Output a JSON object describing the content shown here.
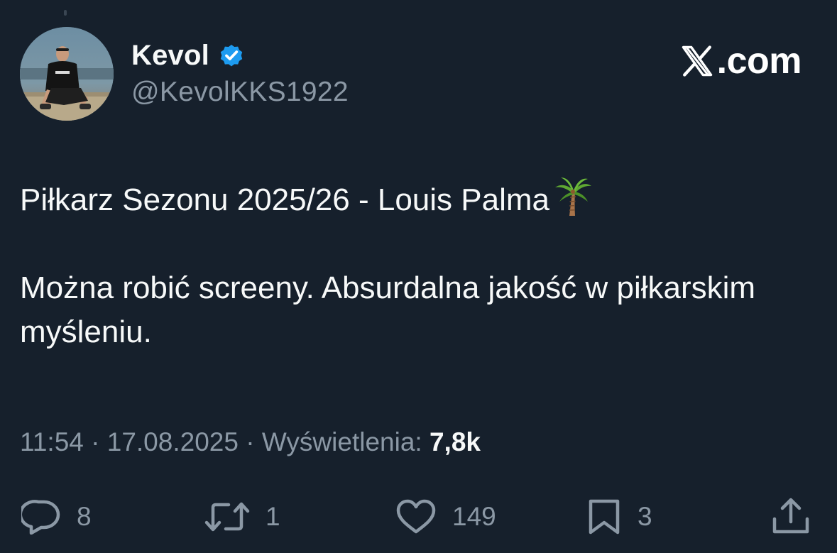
{
  "author": {
    "display_name": "Kevol",
    "handle": "@KevolKKS1922",
    "verified": true,
    "verified_icon": "verified-badge-icon",
    "badge_color": "#1d9bf0"
  },
  "brand": {
    "suffix": ".com",
    "icon": "x-logo-icon"
  },
  "tweet": {
    "line1": "Piłkarz Sezonu 2025/26 - Louis Palma",
    "line1_emoji_icon": "palm-tree-icon",
    "line2": "Można robić screeny. Absurdalna jakość w piłkarskim myśleniu."
  },
  "meta": {
    "time": "11:54",
    "separator": " · ",
    "date": "17.08.2025",
    "views_label": "Wyświetlenia:",
    "views_count": "7,8k"
  },
  "actions": {
    "reply_count": "8",
    "retweet_count": "1",
    "like_count": "149",
    "bookmark_count": "3"
  },
  "colors": {
    "background": "#16202c",
    "text_primary": "#f7f9f9",
    "text_secondary": "#8b98a5"
  }
}
